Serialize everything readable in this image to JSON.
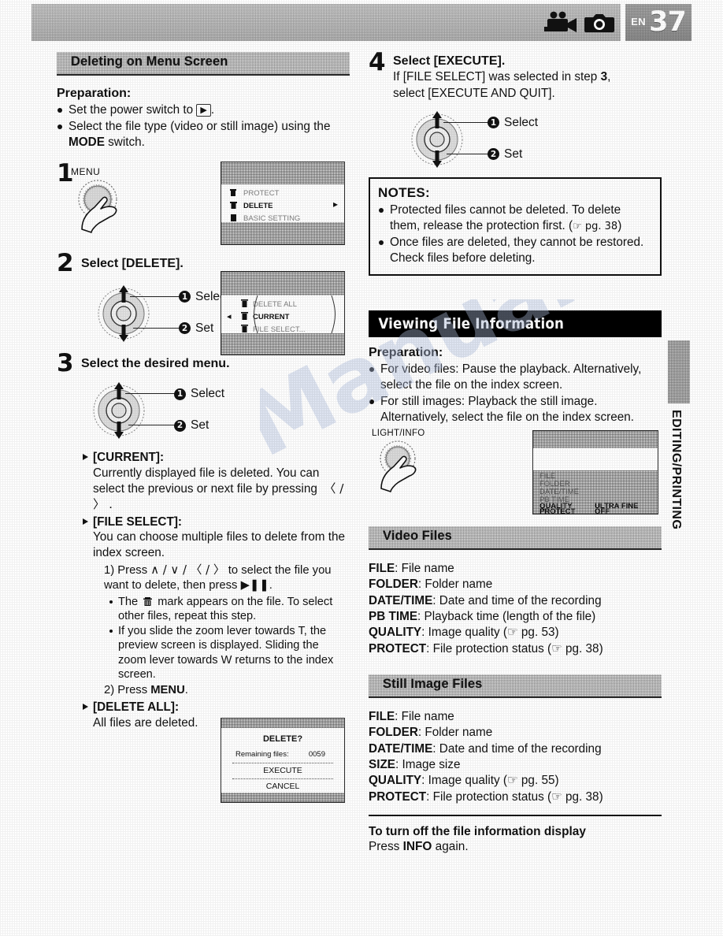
{
  "header": {
    "page_prefix": "EN",
    "page_number": "37",
    "icon_video": "camcorder-icon",
    "icon_still": "still-camera-icon"
  },
  "side_tab": {
    "label": "EDITING/PRINTING"
  },
  "watermark": {
    "text": "Manuals.co"
  },
  "left": {
    "section_title": "Deleting on Menu Screen",
    "preparation": {
      "title": "Preparation:",
      "items": [
        {
          "pre": "Set the power switch to ",
          "icon": "▶",
          "post": "."
        },
        {
          "pre": "Select the file type (video or still image) using the ",
          "bold": "MODE",
          "post": " switch."
        }
      ]
    },
    "step1": {
      "number": "1",
      "button_label": "MENU",
      "lcd_rows": [
        {
          "label": "PROTECT",
          "dim": true
        },
        {
          "label": "DELETE",
          "dim": false
        },
        {
          "label": "BASIC SETTING",
          "dim": true
        }
      ]
    },
    "step2": {
      "number": "2",
      "title": "Select [DELETE].",
      "callout1": "Select",
      "callout2": "Set",
      "lcd_rows": [
        {
          "label": "DELETE ALL",
          "dim": true
        },
        {
          "label": "CURRENT",
          "dim": false
        },
        {
          "label": "FILE SELECT...",
          "dim": true
        }
      ]
    },
    "step3": {
      "number": "3",
      "title": "Select the desired menu.",
      "callout1": "Select",
      "callout2": "Set",
      "options": [
        {
          "name": "[CURRENT]:",
          "body": "Currently displayed file is deleted. You can select the previous or next file by pressing",
          "keys": "〈 / 〉 ."
        },
        {
          "name": "[FILE SELECT]:",
          "body": "You can choose multiple files to delete from the index screen."
        },
        {
          "name": "[DELETE ALL]:",
          "body": "All files are deleted."
        }
      ],
      "sub1_pre": "1) Press ",
      "sub1_keys": "∧ / ∨ / 〈 / 〉",
      "sub1_mid": " to select the file you want to delete, then press ",
      "sub1_play": "▶❚❚",
      "sub1_post": ".",
      "subbullets": [
        {
          "pre": "The ",
          "icon": "trash-icon",
          "post": " mark appears on the file. To select other files, repeat this step."
        },
        {
          "text": "If you slide the zoom lever towards T, the preview screen is displayed. Sliding the zoom lever towards W returns to the index screen."
        }
      ],
      "sub2_pre": "2) Press ",
      "sub2_bold": "MENU",
      "sub2_post": "."
    },
    "dialog": {
      "title": "DELETE?",
      "remaining_label": "Remaining files:",
      "remaining_value": "0059",
      "execute": "EXECUTE",
      "cancel": "CANCEL"
    }
  },
  "right": {
    "step4": {
      "number": "4",
      "title": "Select [EXECUTE].",
      "sub_pre": "If [FILE SELECT] was selected in step ",
      "sub_bold": "3",
      "sub_post": ",",
      "sub_line2": "select [EXECUTE AND QUIT].",
      "callout1": "Select",
      "callout2": "Set"
    },
    "notes": {
      "title": "NOTES:",
      "items": [
        {
          "text": "Protected files cannot be deleted. To delete them, release the protection first. (",
          "ref": "☞ pg. 38",
          "post": ")"
        },
        {
          "text": "Once files are deleted, they cannot be restored. Check files before deleting."
        }
      ]
    },
    "section_title": "Viewing File Information",
    "preparation": {
      "title": "Preparation:",
      "items": [
        {
          "text": "For video files: Pause the playback. Alternatively, select the file on the index screen."
        },
        {
          "text": "For still images: Playback the still image. Alternatively, select the file on the index screen."
        }
      ]
    },
    "info_button": {
      "label": "LIGHT/INFO"
    },
    "info_lcd_rows": [
      {
        "label": "FILE",
        "value": "",
        "dim": true
      },
      {
        "label": "FOLDER",
        "value": "",
        "dim": true
      },
      {
        "label": "DATE/TIME",
        "value": "",
        "dim": true
      },
      {
        "label": "PB TIME",
        "value": "",
        "dim": true
      },
      {
        "label": "QUALITY",
        "value": "ULTRA FINE",
        "dim": false
      },
      {
        "label": "PROTECT",
        "value": "OFF",
        "dim": false
      }
    ],
    "video_files": {
      "heading": "Video Files",
      "rows": [
        {
          "term": "FILE",
          "desc": ": File name"
        },
        {
          "term": "FOLDER",
          "desc": ": Folder name"
        },
        {
          "term": "DATE/TIME",
          "desc": ": Date and time of the recording"
        },
        {
          "term": "PB TIME",
          "desc": ": Playback time (length of the file)"
        },
        {
          "term": "QUALITY",
          "desc": ": Image quality (☞ pg. 53)"
        },
        {
          "term": "PROTECT",
          "desc": ": File protection status (☞ pg. 38)"
        }
      ]
    },
    "still_files": {
      "heading": "Still Image Files",
      "rows": [
        {
          "term": "FILE",
          "desc": ": File name"
        },
        {
          "term": "FOLDER",
          "desc": ": Folder name"
        },
        {
          "term": "DATE/TIME",
          "desc": ": Date and time of the recording"
        },
        {
          "term": "SIZE",
          "desc": ": Image size"
        },
        {
          "term": "QUALITY",
          "desc": ": Image quality (☞ pg. 55)"
        },
        {
          "term": "PROTECT",
          "desc": ": File protection status (☞ pg. 38)"
        }
      ]
    },
    "footer": {
      "title": "To turn off the file information display",
      "pre": "Press ",
      "bold": "INFO",
      "post": " again."
    }
  }
}
